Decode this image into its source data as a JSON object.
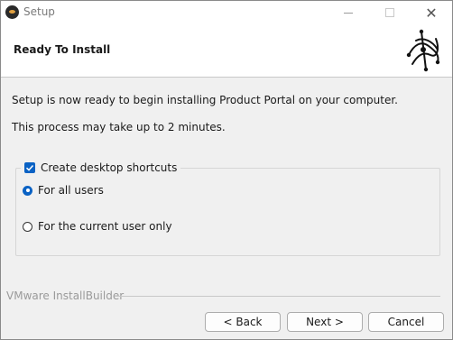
{
  "window": {
    "title": "Setup",
    "app_icon": "installbuilder-logo-icon",
    "controls": {
      "minimize_icon": "minimize-icon",
      "maximize_icon": "maximize-icon",
      "close_glyph": "✕"
    }
  },
  "header": {
    "title": "Ready To Install",
    "logo_icon": "installbuilder-logo-icon"
  },
  "content": {
    "line1": "Setup is now ready to begin installing Product Portal on your computer.",
    "line2": "This process may take up to 2 minutes."
  },
  "options": {
    "desktop_shortcuts_label": "Create desktop shortcuts",
    "desktop_shortcuts_checked": true,
    "radio_options": [
      {
        "label": "For all users",
        "selected": true
      },
      {
        "label": "For the current user only",
        "selected": false
      }
    ]
  },
  "footer": {
    "brand": "VMware InstallBuilder",
    "back_label": "< Back",
    "next_label": "Next >",
    "cancel_label": "Cancel"
  },
  "colors": {
    "accent": "#0a62c4",
    "window_bg": "#f0f0f0",
    "header_bg": "#ffffff"
  }
}
